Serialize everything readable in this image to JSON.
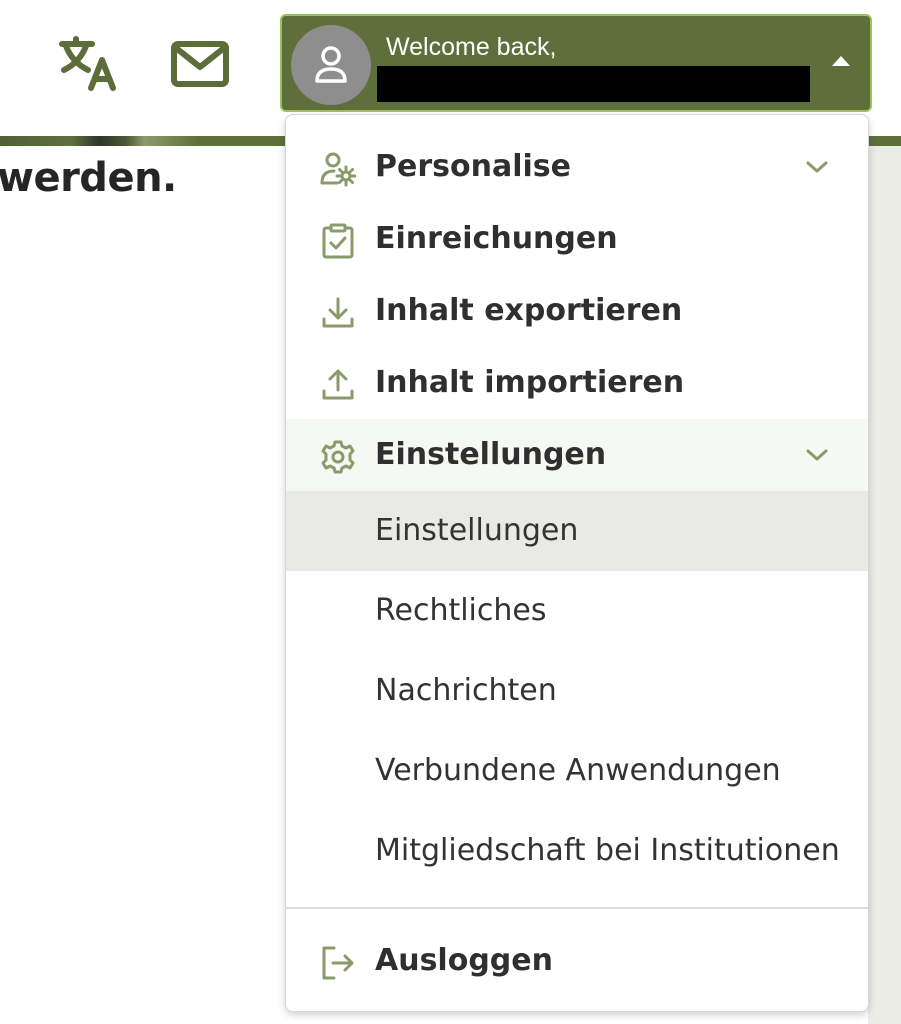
{
  "page": {
    "heading": "werden."
  },
  "header": {
    "translate_icon": "translate-icon",
    "mail_icon": "mail-icon",
    "colors": {
      "brand": "#5f6f3c",
      "brand_border": "#9ec25a",
      "icon": "#5c6d39",
      "menu_icon": "#8a9a6a"
    }
  },
  "user_menu": {
    "welcome": "Welcome back,",
    "user_name": "",
    "caret_icon": "caret-up-icon",
    "avatar_icon": "user-icon"
  },
  "menu": {
    "items": [
      {
        "label": "Personalise",
        "icon": "user-gear-icon",
        "expandable": true
      },
      {
        "label": "Einreichungen",
        "icon": "clipboard-check-icon"
      },
      {
        "label": "Inhalt exportieren",
        "icon": "download-icon"
      },
      {
        "label": "Inhalt importieren",
        "icon": "upload-icon"
      },
      {
        "label": "Einstellungen",
        "icon": "gear-icon",
        "expandable": true,
        "expanded": true
      }
    ],
    "settings_sub": [
      {
        "label": "Einstellungen",
        "active": true
      },
      {
        "label": "Rechtliches"
      },
      {
        "label": "Nachrichten"
      },
      {
        "label": "Verbundene Anwendungen"
      },
      {
        "label": "Mitgliedschaft bei Institutionen"
      }
    ],
    "logout": {
      "label": "Ausloggen",
      "icon": "logout-icon"
    }
  }
}
